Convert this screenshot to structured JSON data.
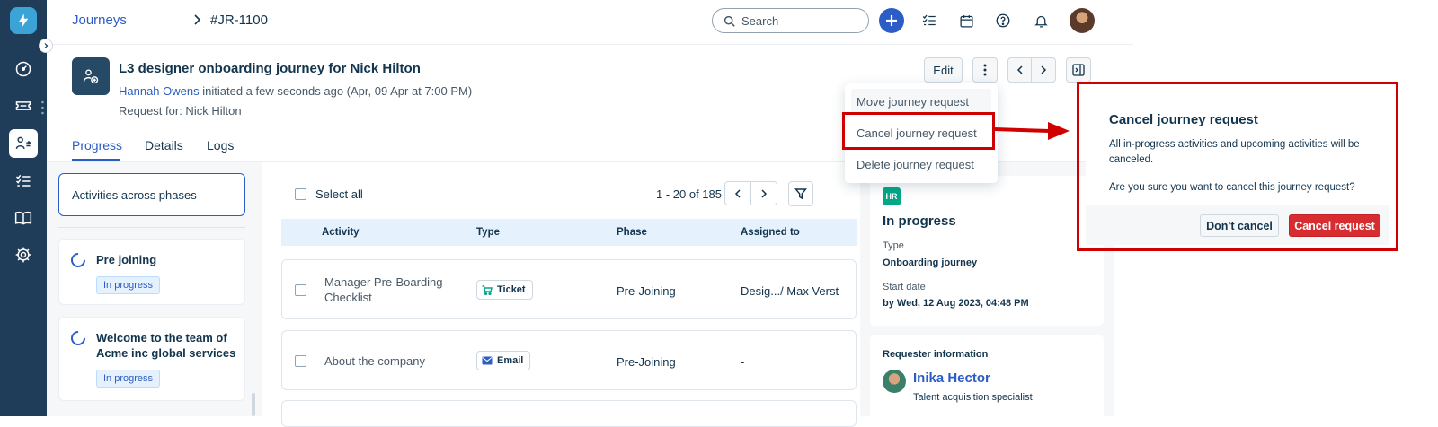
{
  "breadcrumb": {
    "root": "Journeys",
    "current": "#JR-1100"
  },
  "search": {
    "placeholder": "Search"
  },
  "header": {
    "title": "L3 designer onboarding journey for Nick Hilton",
    "initiator": "Hannah Owens",
    "initiated_text": "initiated a few seconds ago (Apr, 09 Apr at 7:00 PM)",
    "request_for": "Request for: Nick Hilton",
    "edit_label": "Edit"
  },
  "tabs": [
    {
      "label": "Progress"
    },
    {
      "label": "Details"
    },
    {
      "label": "Logs"
    }
  ],
  "phases": {
    "filter_label": "Activities across phases",
    "items": [
      {
        "name": "Pre joining",
        "status": "In progress"
      },
      {
        "name_line1": "Welcome to the team of",
        "name_line2": "Acme inc global services",
        "status": "In progress"
      }
    ]
  },
  "list": {
    "select_all": "Select all",
    "pagination": "1 - 20 of 185",
    "columns": [
      "Activity",
      "Type",
      "Phase",
      "Assigned to"
    ],
    "rows": [
      {
        "activity_line1": "Manager Pre-Boarding",
        "activity_line2": "Checklist",
        "type": "Ticket",
        "phase": "Pre-Joining",
        "assigned": "Desig.../ Max Verst"
      },
      {
        "activity": "About the company",
        "type": "Email",
        "phase": "Pre-Joining",
        "assigned": "-"
      }
    ]
  },
  "menu": {
    "items": [
      "Move journey request",
      "Cancel journey request",
      "Delete journey request"
    ]
  },
  "details": {
    "badge": "HR",
    "status": "In progress",
    "type_label": "Type",
    "type_value": "Onboarding journey",
    "start_label": "Start date",
    "start_value": "by Wed, 12 Aug 2023, 04:48 PM"
  },
  "requester": {
    "title": "Requester information",
    "name": "Inika Hector",
    "role": "Talent acquisition specialist"
  },
  "modal": {
    "title": "Cancel journey request",
    "body": "All in-progress activities and upcoming activities will be canceled.",
    "question": "Are you sure you want to cancel this journey request?",
    "secondary": "Don't cancel",
    "primary": "Cancel request"
  },
  "colors": {
    "sidebar": "#1f3d58",
    "accent": "#2c5cc5",
    "danger": "#d72d30",
    "annotation": "#d00000",
    "hr_badge": "#00a886"
  },
  "icons": [
    "lightning-icon",
    "dashboard-icon",
    "ticket-icon",
    "journey-icon",
    "tasks-icon",
    "book-icon",
    "gear-icon",
    "search-icon",
    "plus-icon",
    "checklist-icon",
    "calendar-icon",
    "help-icon",
    "bell-icon",
    "more-icon",
    "chevron-left-icon",
    "chevron-right-icon",
    "panel-icon",
    "filter-icon",
    "cart-icon",
    "mail-icon"
  ]
}
